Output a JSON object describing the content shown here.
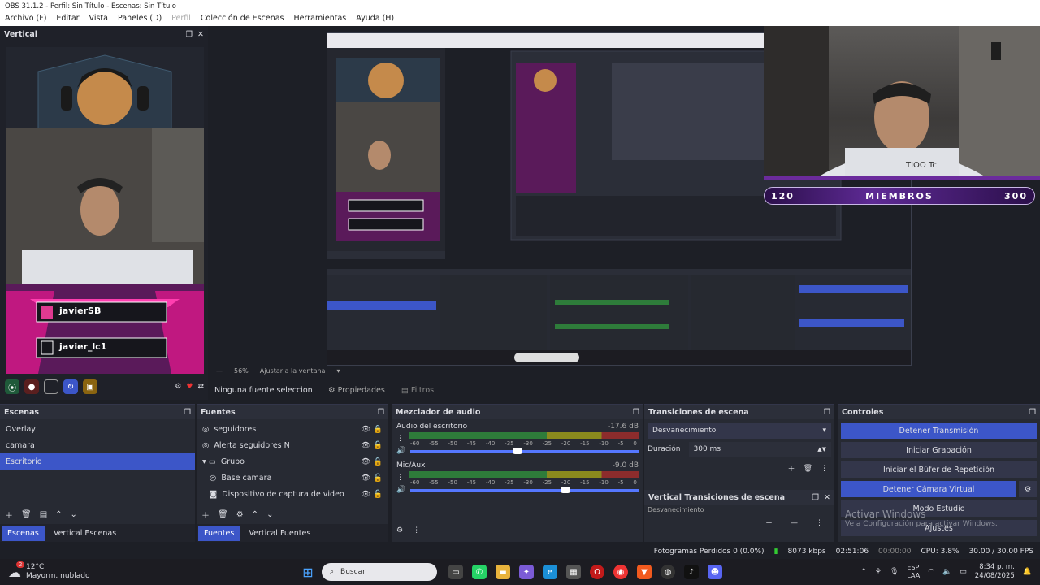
{
  "title": "OBS 31.1.2 - Perfil: Sin Título - Escenas: Sin Título",
  "menu": [
    "Archivo (F)",
    "Editar",
    "Vista",
    "Paneles (D)",
    "Perfil",
    "Colección de Escenas",
    "Herramientas",
    "Ayuda (H)"
  ],
  "vertical_panel": {
    "title": "Vertical",
    "usernames": [
      "javierSB",
      "javier_lc1"
    ]
  },
  "overlay": {
    "left": "120",
    "center": "MIEMBROS",
    "right": "300"
  },
  "zoom": {
    "percent": "56%",
    "fit": "Ajustar a la ventana"
  },
  "source_bar": {
    "selected": "Ninguna fuente seleccionada",
    "props": "Propiedades",
    "filters": "Filtros"
  },
  "scenes": {
    "title": "Escenas",
    "items": [
      "Overlay",
      "camara",
      "Escritorio"
    ],
    "selected": 2,
    "tabs": [
      "Escenas",
      "Vertical Escenas"
    ]
  },
  "sources": {
    "title": "Fuentes",
    "items": [
      "seguidores",
      "Alerta seguidores N",
      "Grupo",
      "Base camara",
      "Dispositivo de captura de video"
    ],
    "tabs": [
      "Fuentes",
      "Vertical Fuentes"
    ]
  },
  "mixer": {
    "title": "Mezclador de audio",
    "channels": [
      {
        "name": "Audio del escritorio",
        "db": "-17.6 dB",
        "level": 0.47
      },
      {
        "name": "Mic/Aux",
        "db": "-9.0 dB",
        "level": 0.68
      }
    ],
    "ticks": [
      "-60",
      "-55",
      "-50",
      "-45",
      "-40",
      "-35",
      "-30",
      "-25",
      "-20",
      "-15",
      "-10",
      "-5",
      "0"
    ]
  },
  "transitions": {
    "title": "Transiciones de escena",
    "type": "Desvanecimiento",
    "duration_label": "Duración",
    "duration": "300 ms",
    "vertical_title": "Vertical Transiciones de escena",
    "vertical_type": "Desvanecimiento"
  },
  "controls": {
    "title": "Controles",
    "buttons": [
      "Detener Transmisión",
      "Iniciar Grabación",
      "Iniciar el Búfer de Repetición",
      "Detener Cámara Virtual",
      "Modo Estudio",
      "Ajustes"
    ]
  },
  "watermark": {
    "line1": "Activar Windows",
    "line2": "Ve a Configuración para activar Windows."
  },
  "status": {
    "dropped": "Fotogramas Perdidos 0 (0.0%)",
    "kbps": "8073 kbps",
    "time": "02:51:06",
    "rec": "00:00:00",
    "cpu": "CPU: 3.8%",
    "fps": "30.00 / 30.00 FPS"
  },
  "taskbar": {
    "weather_temp": "12°C",
    "weather_desc": "Mayorm. nublado",
    "search": "Buscar",
    "lang1": "ESP",
    "lang2": "LAA",
    "clock": "8:34 p. m.",
    "date": "24/08/2025",
    "badge": "2"
  },
  "colors": {
    "accent": "#3c56c8",
    "dock": "#272a33",
    "overlay_purple": "#5e2a95"
  }
}
